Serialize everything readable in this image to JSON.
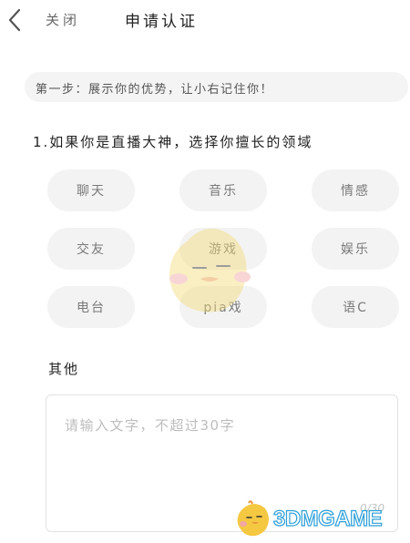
{
  "header": {
    "back_icon": "chevron-left-icon",
    "close_label": "关闭",
    "title": "申请认证"
  },
  "step_banner": "第一步：展示你的优势，让小右记住你！",
  "question": "1.如果你是直播大神，选择你擅长的领域",
  "tags": [
    "聊天",
    "音乐",
    "情感",
    "交友",
    "游戏",
    "娱乐",
    "电台",
    "pia戏",
    "语C"
  ],
  "other": {
    "label": "其他",
    "placeholder": "请输入文字，不超过30字",
    "counter": "0/30"
  },
  "watermark": {
    "text": "3DMGAME",
    "colors": {
      "stroke": "#2d9fd8",
      "bird": "#f5c842"
    }
  }
}
